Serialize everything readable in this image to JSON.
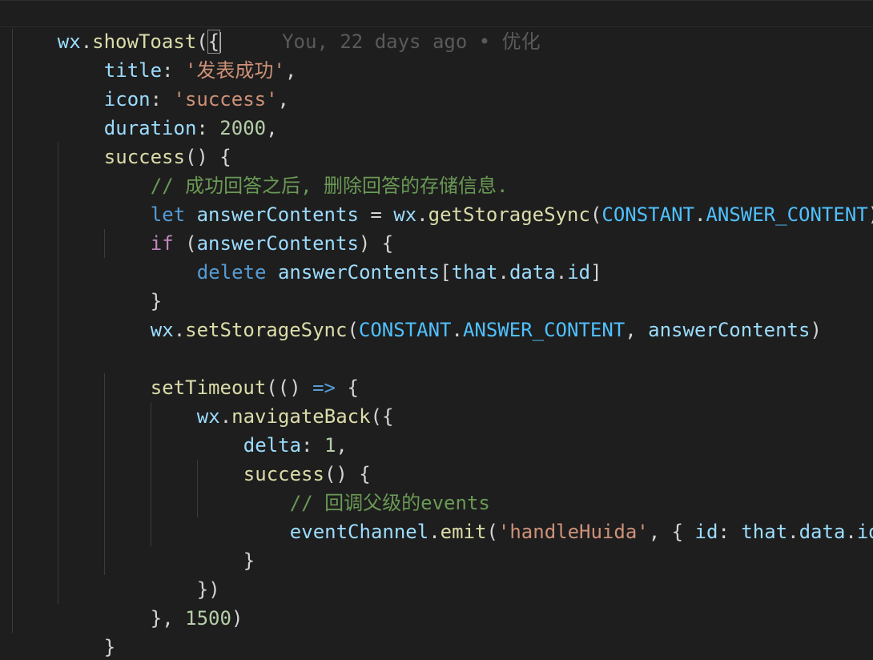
{
  "blame": {
    "text": "You, 22 days ago • 优化"
  },
  "code": {
    "l1": {
      "a": "wx",
      "b": ".",
      "c": "showToast",
      "d": "(",
      "e": "{"
    },
    "l2": {
      "a": "title",
      "b": ": ",
      "c": "'发表成功'",
      "d": ","
    },
    "l3": {
      "a": "icon",
      "b": ": ",
      "c": "'success'",
      "d": ","
    },
    "l4": {
      "a": "duration",
      "b": ": ",
      "c": "2000",
      "d": ","
    },
    "l5": {
      "a": "success",
      "b": "() {"
    },
    "l6": {
      "a": "// 成功回答之后, 删除回答的存储信息."
    },
    "l7": {
      "a": "let",
      "b": " ",
      "c": "answerContents",
      "d": " = ",
      "e": "wx",
      "f": ".",
      "g": "getStorageSync",
      "h": "(",
      "i": "CONSTANT",
      "j": ".",
      "k": "ANSWER_CONTENT",
      "l": ")"
    },
    "l8": {
      "a": "if",
      "b": " (",
      "c": "answerContents",
      "d": ") {"
    },
    "l9": {
      "a": "delete",
      "b": " ",
      "c": "answerContents",
      "d": "[",
      "e": "that",
      "f": ".",
      "g": "data",
      "h": ".",
      "i": "id",
      "j": "]"
    },
    "l10": {
      "a": "}"
    },
    "l11": {
      "a": "wx",
      "b": ".",
      "c": "setStorageSync",
      "d": "(",
      "e": "CONSTANT",
      "f": ".",
      "g": "ANSWER_CONTENT",
      "h": ", ",
      "i": "answerContents",
      "j": ")"
    },
    "l13": {
      "a": "setTimeout",
      "b": "(() ",
      "c": "=>",
      "d": " {"
    },
    "l14": {
      "a": "wx",
      "b": ".",
      "c": "navigateBack",
      "d": "({"
    },
    "l15": {
      "a": "delta",
      "b": ": ",
      "c": "1",
      "d": ","
    },
    "l16": {
      "a": "success",
      "b": "() {"
    },
    "l17": {
      "a": "// 回调父级的events"
    },
    "l18": {
      "a": "eventChannel",
      "b": ".",
      "c": "emit",
      "d": "(",
      "e": "'handleHuida'",
      "f": ", { ",
      "g": "id",
      "h": ": ",
      "i": "that",
      "j": ".",
      "k": "data",
      "l": ".",
      "m": "id",
      "n": " })"
    },
    "l19": {
      "a": "}"
    },
    "l20": {
      "a": "})"
    },
    "l21": {
      "a": "}, ",
      "b": "1500",
      "c": ")"
    },
    "l22": {
      "a": "}"
    },
    "l23": {
      "a": "}",
      "b": ")"
    }
  }
}
